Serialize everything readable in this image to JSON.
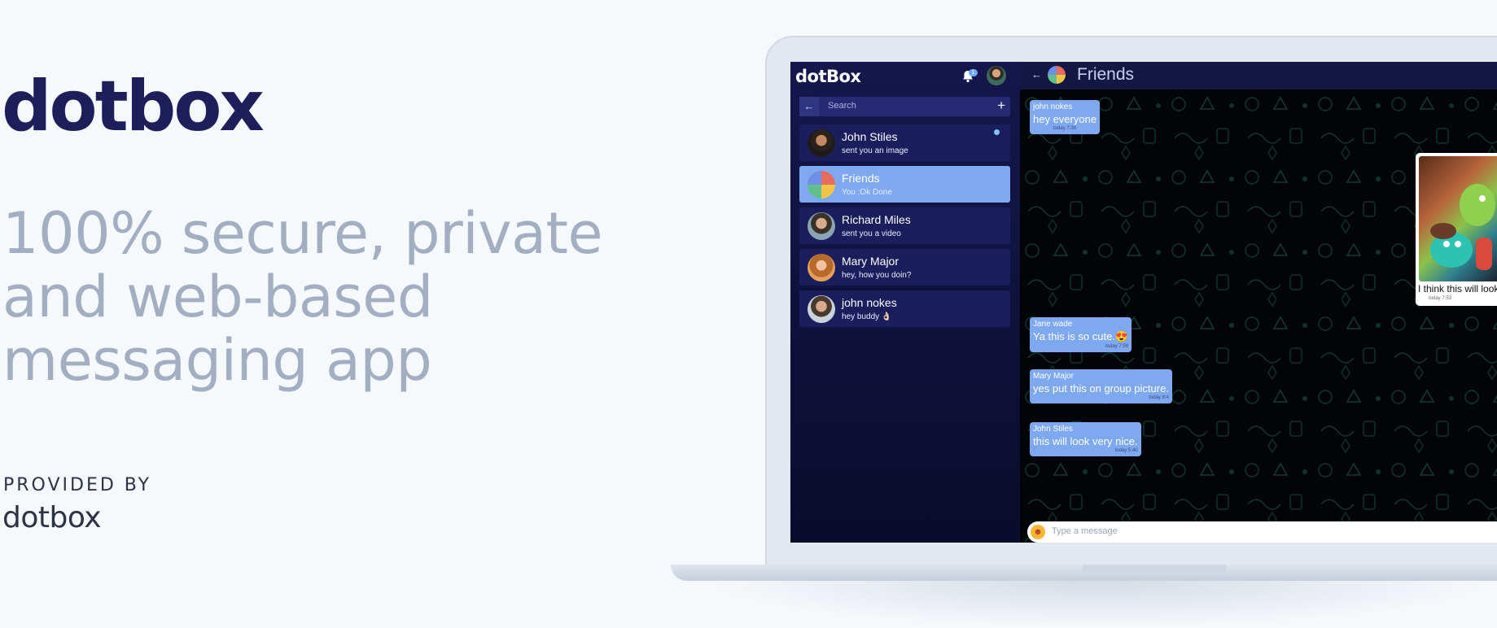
{
  "hero": {
    "title": "dotbox",
    "tagline_lines": [
      "100% secure, private",
      "and web-based",
      "messaging app"
    ],
    "provided_by_label": "PROVIDED BY",
    "provided_by_name": "dotbox"
  },
  "app": {
    "logo": "dotBox",
    "notification_count": "1",
    "search": {
      "placeholder": "Search"
    },
    "chats": [
      {
        "name": "John Stiles",
        "preview": "sent you an image",
        "unread": true,
        "active": false
      },
      {
        "name": "Friends",
        "preview": "You :Ok Done",
        "unread": false,
        "active": true
      },
      {
        "name": "Richard Miles",
        "preview": "sent you a video",
        "unread": false,
        "active": false
      },
      {
        "name": "Mary Major",
        "preview": "hey, how you doin?",
        "unread": false,
        "active": false
      },
      {
        "name": "john nokes",
        "preview": "hey buddy 👌🏻",
        "unread": false,
        "active": false
      }
    ],
    "conversation": {
      "title": "Friends",
      "messages": [
        {
          "sender": "john nokes",
          "text": "hey everyone",
          "time": "today 7:39"
        },
        {
          "sender": "Jane wade",
          "text": "Ya this is so cute.😍",
          "time": "today 7:59"
        },
        {
          "sender": "Mary Major",
          "text": "yes put this on group picture.",
          "time": "today 8:4"
        },
        {
          "sender": "John Stiles",
          "text": "this will look very nice.",
          "time": "today 5:40"
        }
      ],
      "image_message": {
        "caption": "I think this will look",
        "time": "today 7:53"
      },
      "input": {
        "placeholder": "Type a message"
      }
    }
  },
  "colors": {
    "brand_dark": "#1e1f5a",
    "tagline": "#a2afc2",
    "sidebar": "#15174d",
    "bubble": "#7ea8ef",
    "chat_background": "#030407"
  }
}
